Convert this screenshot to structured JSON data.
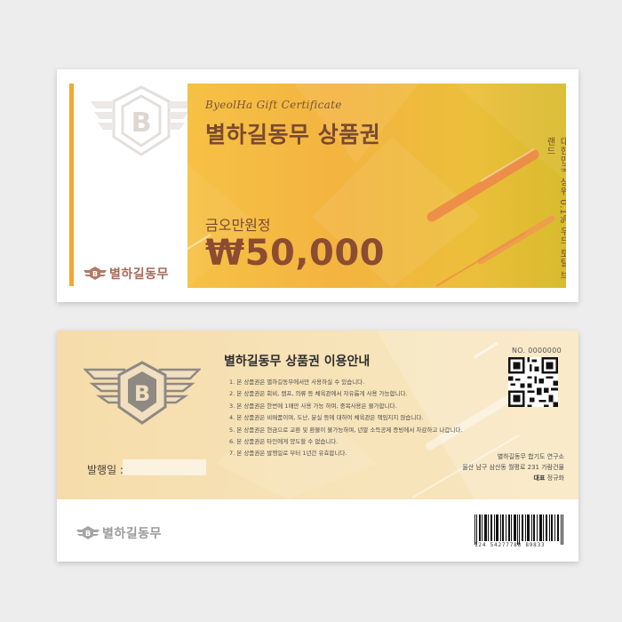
{
  "front": {
    "certificate_script": "ByeolHa Gift Certificate",
    "title": "별하길동무 상품권",
    "amount_words": "금오만원정",
    "amount": "₩50,000",
    "vertical_slogan": "대한민국 상위 0.1% 우드 토탈 브랜드",
    "brand_name": "별하길동무",
    "emblem_letter": "B"
  },
  "back": {
    "title": "별하길동무 상품권 이용안내",
    "rules": [
      "1. 본 상품권은 별하길동무에서만 사용하실 수 있습니다.",
      "2. 본 상품권은 회비, 캠프, 의류 등 체육관에서 자유롭게 사용 가능합니다.",
      "3. 본 상품권은 한번에 1매만 사용 가능 하며, 중복사용은 불가합니다.",
      "4. 본 상품권은 비매품이며, 도난, 분실 등에 대하여 체육관은 책임지지 않습니다.",
      "5. 본 상품권은 현금으로 교환 및 환불이 불가능하며, 년말 소득공제 증빙에서 차감하고 나갑니다.",
      "6. 본 상품권은 타인에게 양도할 수 없습니다.",
      "7. 본 상품권은 발행일로 부터 1년간 유효합니다."
    ],
    "issue_date_label": "발행일 :",
    "serial_number": "NO. 0000000",
    "address_line1": "별하길동무 합기도 연구소",
    "address_line2": "울산 남구 삼산동 월평로 231 가람건물",
    "representative_label": "대표",
    "representative_name": "정규화",
    "brand_name": "별하길동무",
    "barcode_number": "124 54277788 89833",
    "emblem_letter": "B"
  },
  "colors": {
    "gold": "#f3b440",
    "brown": "#7a4a30",
    "cream": "#f7e3b8"
  }
}
